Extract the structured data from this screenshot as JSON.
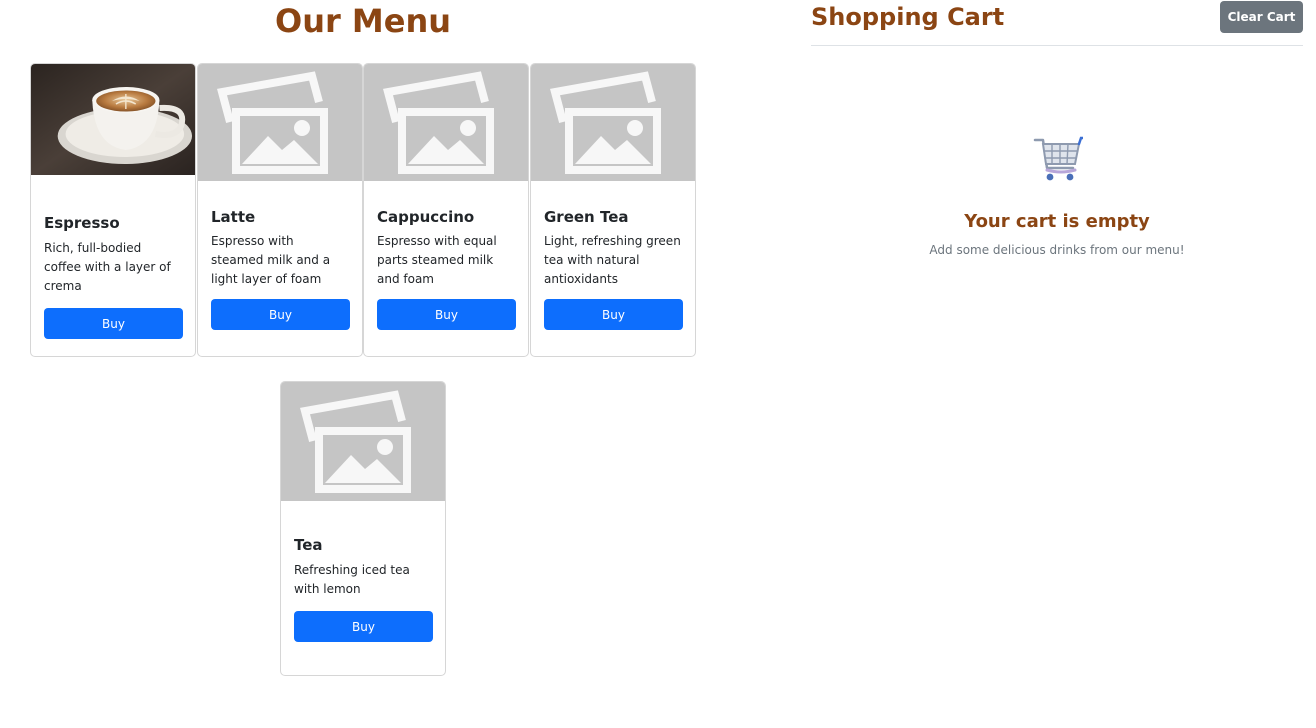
{
  "menu": {
    "title": "Our Menu",
    "items": [
      {
        "name": "Espresso",
        "description": "Rich, full-bodied coffee with a layer of crema",
        "button": "Buy",
        "image": "coffee-photo"
      },
      {
        "name": "Latte",
        "description": "Espresso with steamed milk and a light layer of foam",
        "button": "Buy",
        "image": "image-placeholder-icon"
      },
      {
        "name": "Cappuccino",
        "description": "Espresso with equal parts steamed milk and foam",
        "button": "Buy",
        "image": "image-placeholder-icon"
      },
      {
        "name": "Green Tea",
        "description": "Light, refreshing green tea with natural antioxidants",
        "button": "Buy",
        "image": "image-placeholder-icon"
      },
      {
        "name": "Tea",
        "description": "Refreshing iced tea with lemon",
        "button": "Buy",
        "image": "image-placeholder-icon"
      }
    ]
  },
  "cart": {
    "title": "Shopping Cart",
    "clear_label": "Clear Cart",
    "empty_icon": "shopping-cart-icon",
    "empty_title": "Your cart is empty",
    "empty_subtitle": "Add some delicious drinks from our menu!"
  },
  "colors": {
    "heading": "#8b4513",
    "primary_button": "#0d6efd",
    "secondary_button": "#6c757d",
    "placeholder_bg": "#c5c5c5"
  }
}
